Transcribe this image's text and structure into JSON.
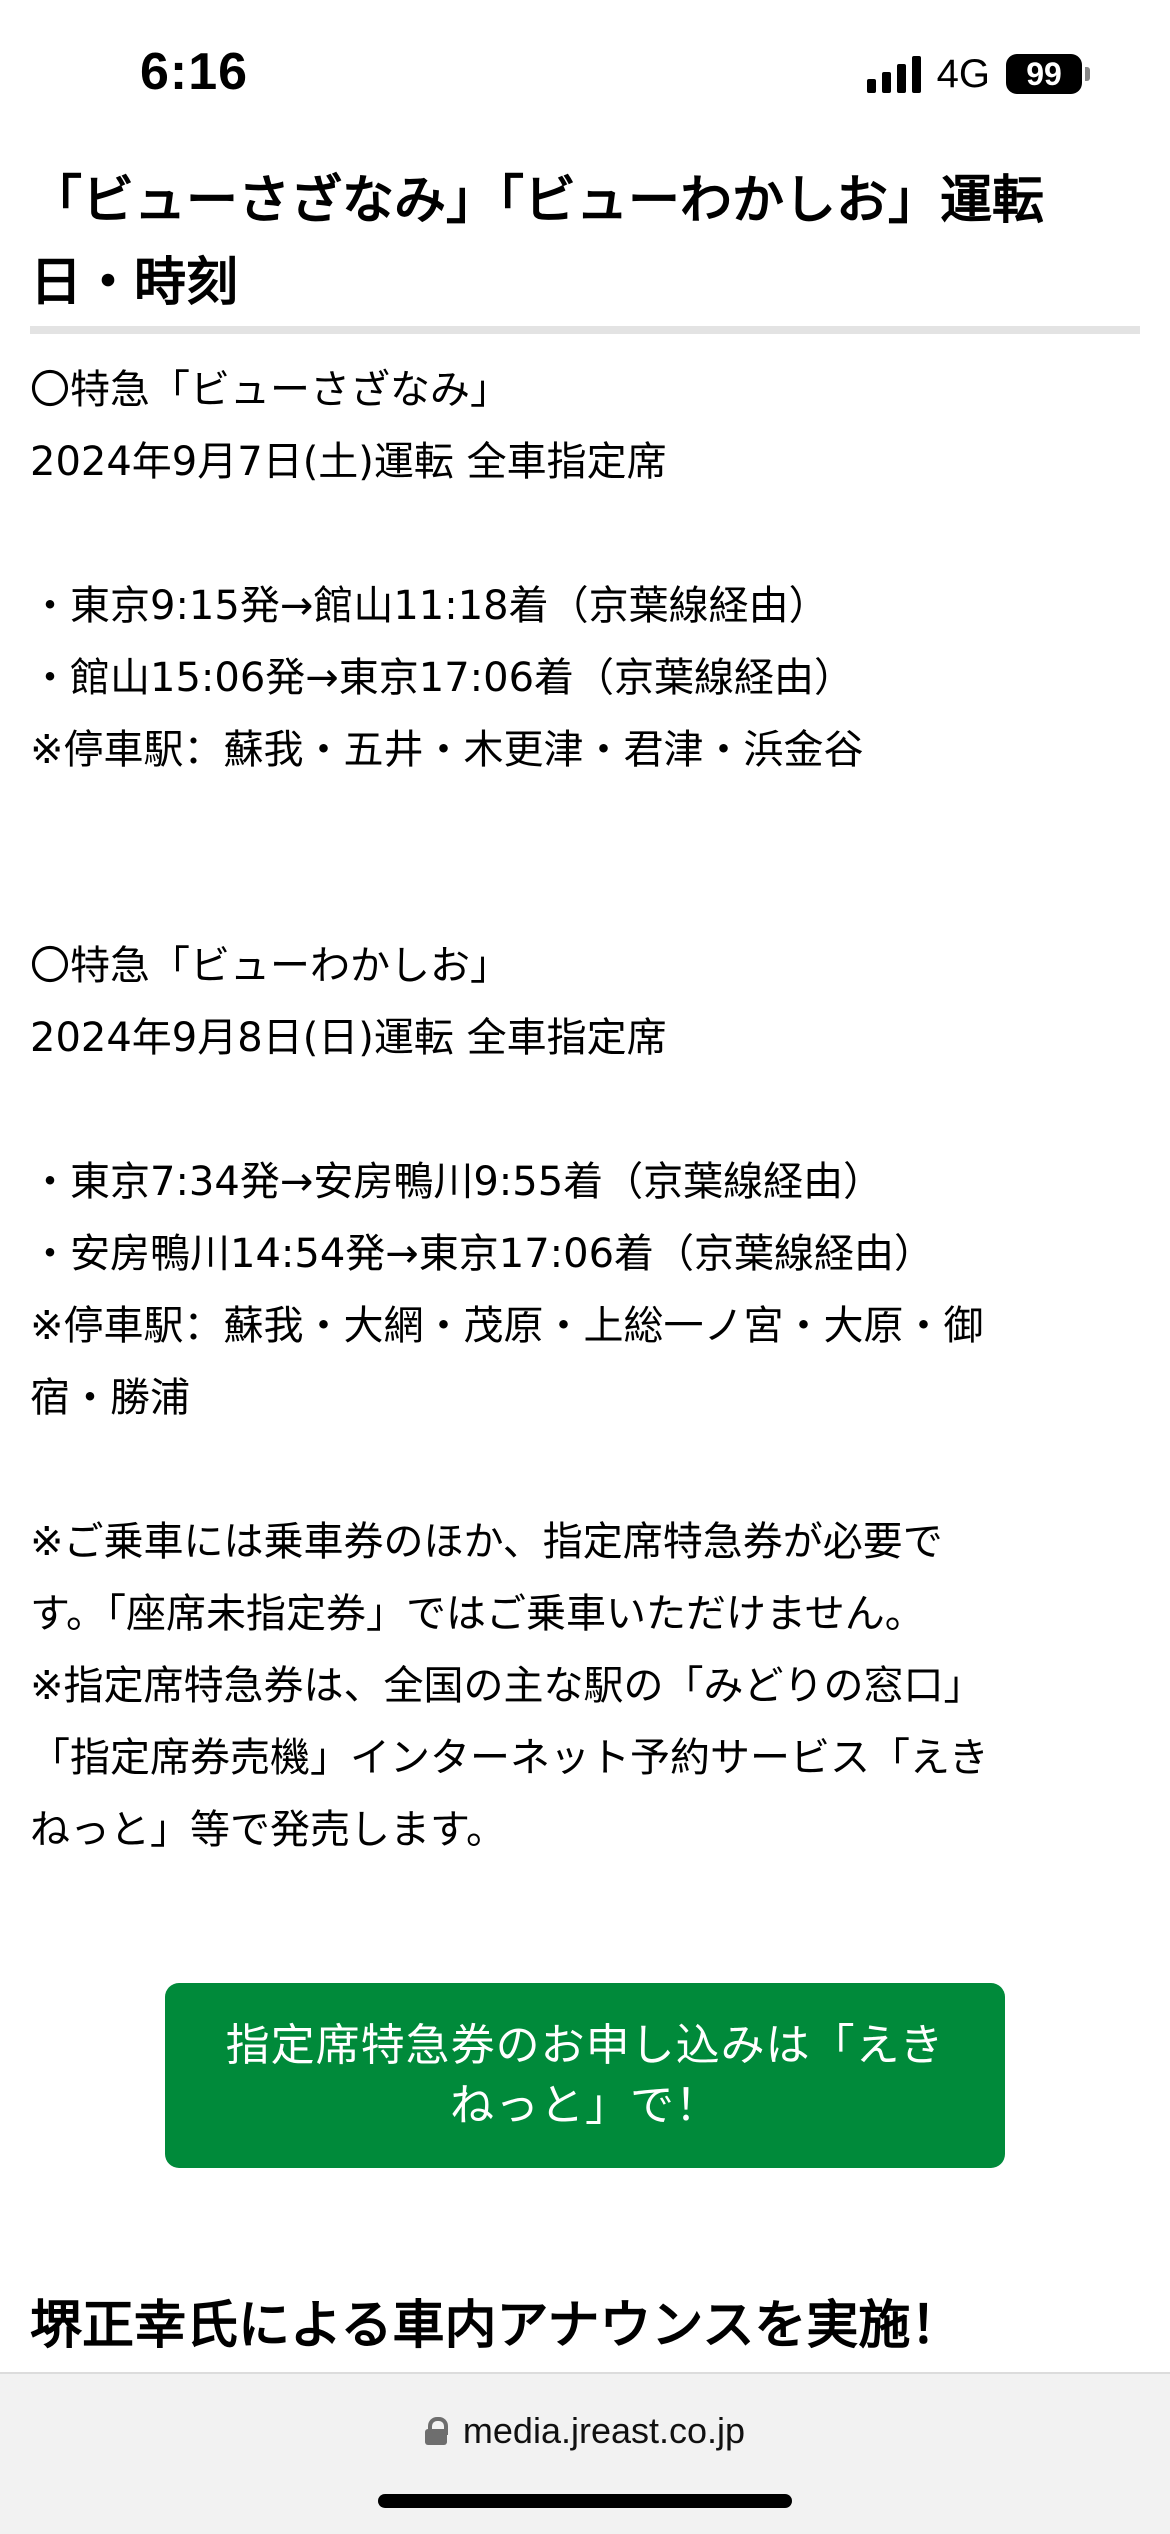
{
  "status_bar": {
    "time": "6:16",
    "network": "4G",
    "battery": "99"
  },
  "article": {
    "title": "「ビューさざなみ」「ビューわかしお」運転日・時刻",
    "lines": [
      "〇特急「ビューさざなみ」",
      "2024年9月7日(土)運転 全車指定席",
      "・東京9:15発→館山11:18着（京葉線経由）",
      "・館山15:06発→東京17:06着（京葉線経由）",
      "※停車駅：蘇我・五井・木更津・君津・浜金谷",
      "〇特急「ビューわかしお」",
      "2024年9月8日(日)運転 全車指定席",
      "・東京7:34発→安房鴨川9:55着（京葉線経由）",
      "・安房鴨川14:54発→東京17:06着（京葉線経由）",
      "※停車駅：蘇我・大網・茂原・上総一ノ宮・大原・御",
      "宿・勝浦",
      "※ご乗車には乗車券のほか、指定席特急券が必要で",
      "す。「座席未指定券」ではご乗車いただけません。",
      "※指定席特急券は、全国の主な駅の「みどりの窓口」",
      "「指定席券売機」インターネット予約サービス「えき",
      "ねっと」等で発売します。"
    ]
  },
  "cta": {
    "label": "指定席特急券のお申し込みは「えきねっと」で！"
  },
  "next_section": {
    "heading": "堺正幸氏による車内アナウンスを実施！"
  },
  "browser": {
    "url": "media.jreast.co.jp"
  }
}
